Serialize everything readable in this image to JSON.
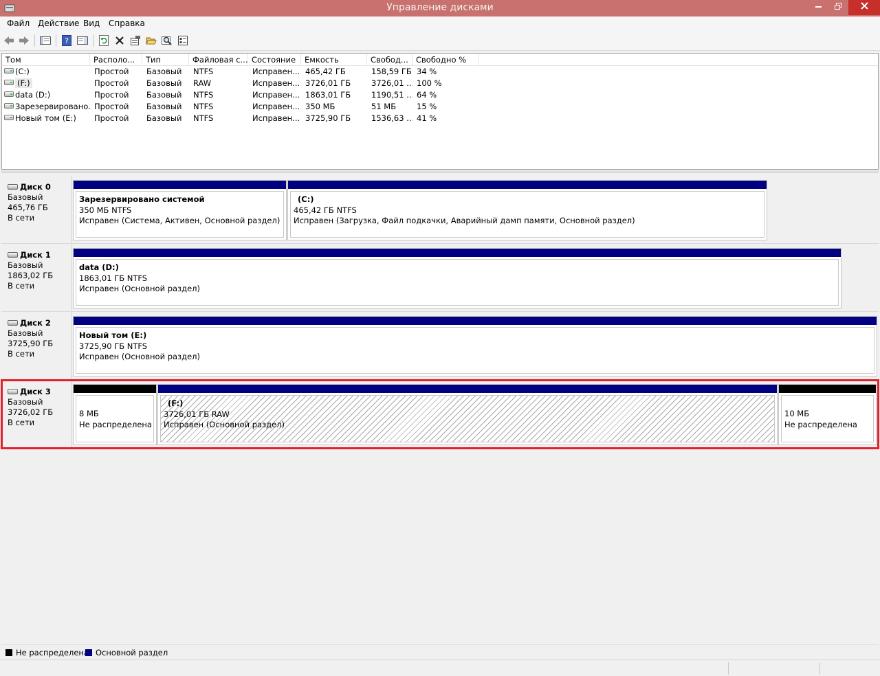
{
  "window": {
    "title": "Управление дисками"
  },
  "menu": [
    {
      "label": "Файл"
    },
    {
      "label": "Действие"
    },
    {
      "label": "Вид"
    },
    {
      "label": "Справка"
    }
  ],
  "volume_list": {
    "columns": [
      "Том",
      "Располо...",
      "Тип",
      "Файловая с...",
      "Состояние",
      "Емкость",
      "Свобод...",
      "Свободно %"
    ],
    "rows": [
      [
        "(C:)",
        "Простой",
        "Базовый",
        "NTFS",
        "Исправен...",
        "465,42 ГБ",
        "158,59 ГБ",
        "34 %"
      ],
      [
        "(F:)",
        "Простой",
        "Базовый",
        "RAW",
        "Исправен...",
        "3726,01 ГБ",
        "3726,01 ...",
        "100 %"
      ],
      [
        "data (D:)",
        "Простой",
        "Базовый",
        "NTFS",
        "Исправен...",
        "1863,01 ГБ",
        "1190,51 ...",
        "64 %"
      ],
      [
        "Зарезервировано...",
        "Простой",
        "Базовый",
        "NTFS",
        "Исправен...",
        "350 МБ",
        "51 МБ",
        "15 %"
      ],
      [
        "Новый том (E:)",
        "Простой",
        "Базовый",
        "NTFS",
        "Исправен...",
        "3725,90 ГБ",
        "1536,63 ...",
        "41 %"
      ]
    ]
  },
  "disks": [
    {
      "name": "Диск 0",
      "type": "Базовый",
      "size": "465,76 ГБ",
      "status": "В сети",
      "partitions": [
        {
          "title": "Зарезервировано системой",
          "size": "350 МБ NTFS",
          "status": "Исправен (Система, Активен, Основной раздел)"
        },
        {
          "title": "(C:)",
          "size": "465,42 ГБ NTFS",
          "status": "Исправен (Загрузка, Файл подкачки, Аварийный дамп памяти, Основной раздел)"
        }
      ]
    },
    {
      "name": "Диск 1",
      "type": "Базовый",
      "size": "1863,02 ГБ",
      "status": "В сети",
      "partitions": [
        {
          "title": "data  (D:)",
          "size": "1863,01 ГБ NTFS",
          "status": "Исправен (Основной раздел)"
        }
      ]
    },
    {
      "name": "Диск 2",
      "type": "Базовый",
      "size": "3725,90 ГБ",
      "status": "В сети",
      "partitions": [
        {
          "title": "Новый том  (E:)",
          "size": "3725,90 ГБ NTFS",
          "status": "Исправен (Основной раздел)"
        }
      ]
    },
    {
      "name": "Диск 3",
      "type": "Базовый",
      "size": "3726,02 ГБ",
      "status": "В сети",
      "partitions": [
        {
          "title": "",
          "size": "8 МБ",
          "status": "Не распределена"
        },
        {
          "title": "(F:)",
          "size": "3726,01 ГБ RAW",
          "status": "Исправен (Основной раздел)"
        },
        {
          "title": "",
          "size": "10 МБ",
          "status": "Не распределена"
        }
      ]
    }
  ],
  "legend": [
    {
      "label": "Не распределена",
      "color": "#000000"
    },
    {
      "label": "Основной раздел",
      "color": "#000080"
    }
  ],
  "colors": {
    "titlebar": "#c8716e",
    "primary_partition": "#000080",
    "unallocated": "#000000",
    "highlight": "#e3202c"
  }
}
